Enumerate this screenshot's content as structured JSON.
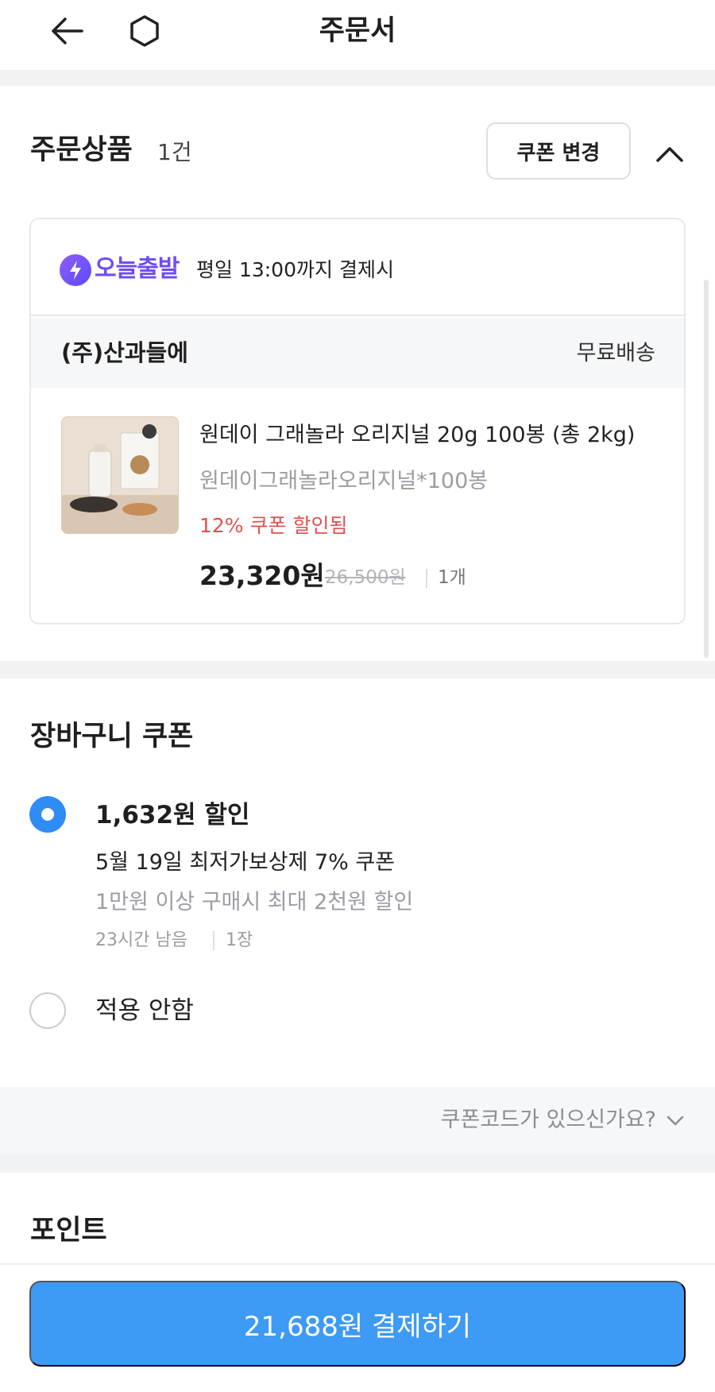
{
  "header": {
    "title": "주문서"
  },
  "order_items": {
    "title": "주문상품",
    "count": "1건",
    "change_coupon_label": "쿠폰 변경",
    "shipping": {
      "badge": "오늘출발",
      "text": "평일 13:00까지 결제시"
    },
    "seller": {
      "name": "(주)산과들에",
      "shipping_fee": "무료배송"
    },
    "product": {
      "name": "원데이 그래놀라 오리지널 20g 100봉 (총 2kg)",
      "option": "원데이그래놀라오리지널*100봉",
      "coupon_note": "12% 쿠폰 할인됨",
      "price": "23,320원",
      "original_price": "26,500원",
      "quantity": "1개",
      "image_icon": "granola-product-image"
    }
  },
  "cart_coupon": {
    "title": "장바구니 쿠폰",
    "options": [
      {
        "selected": true,
        "amount": "1,632원 할인",
        "name": "5월 19일 최저가보상제 7% 쿠폰",
        "condition": "1만원 이상 구매시 최대 2천원 할인",
        "time_left": "23시간 남음",
        "count": "1장"
      },
      {
        "selected": false,
        "label": "적용 안함"
      }
    ],
    "code_prompt": "쿠폰코드가 있으신가요?"
  },
  "points": {
    "title": "포인트"
  },
  "pay": {
    "label": "21,688원 결제하기"
  },
  "colors": {
    "primary": "#3d9af5",
    "discount_red": "#e0514f",
    "badge_purple": "#6f4cf6"
  }
}
